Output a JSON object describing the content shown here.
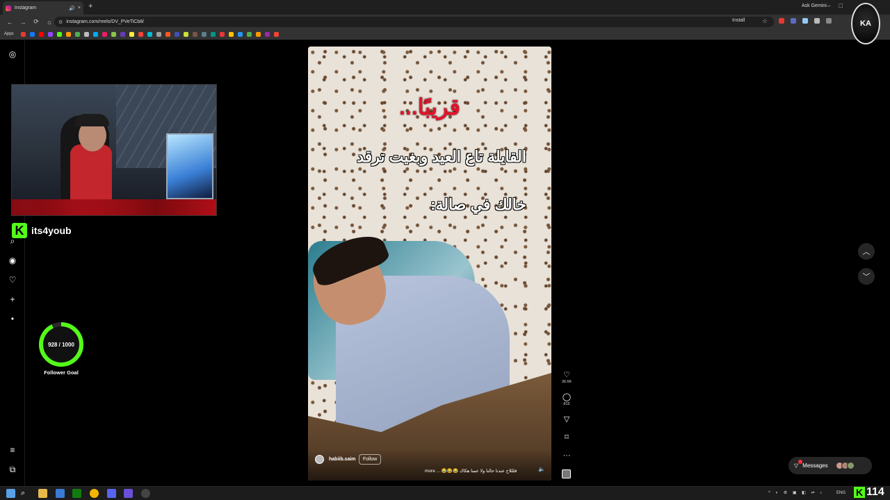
{
  "browser": {
    "tab_title": "Instagram",
    "tab_sound_icon": "speaker-icon",
    "tab_close": "×",
    "new_tab": "+",
    "url": "instagram.com/reels/DV_PVeTiCb8/",
    "ask_gemini": "Ask Gemini",
    "install": "Install",
    "bookmarks_apps": "Apps",
    "nav": {
      "back": "←",
      "forward": "→",
      "reload": "⟳",
      "home": "⌂"
    }
  },
  "stream_overlay": {
    "streamer_name": "its4youb",
    "follower_goal": {
      "current": 928,
      "target": 1000,
      "text": "928 / 1000",
      "label": "Follower Goal"
    },
    "kick_viewer_count": "114"
  },
  "reel": {
    "caption_title": "قريبًا...",
    "caption_line1": "القايلة تاع العيد وبغيت ترقد",
    "caption_line2": "خالك في صالة:",
    "username": "habiib.saim",
    "follow_label": "Follow",
    "description": "قلللاح عندنا حالنا ولا عمنا هكاك 😂😂😂 ... more",
    "likes": "30.6K",
    "comments": "815"
  },
  "messages": {
    "label": "Messages",
    "badge": "5"
  },
  "colors": {
    "kick_green": "#53fc18",
    "ig_red": "#ff3040",
    "caption_red": "#e3132b"
  }
}
